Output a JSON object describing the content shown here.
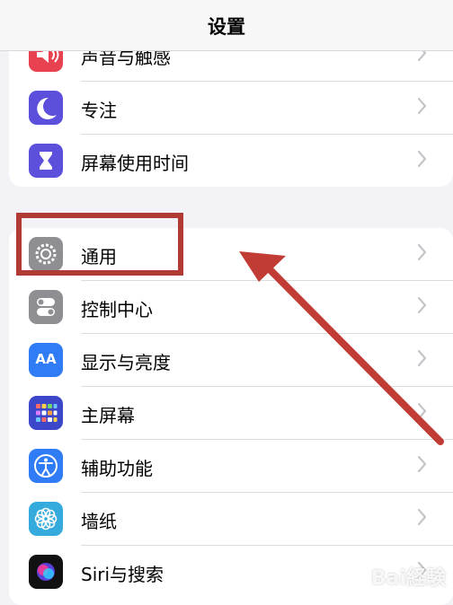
{
  "header": {
    "title": "设置"
  },
  "group1": [
    {
      "label": "声音与触感",
      "icon": "speaker-icon"
    },
    {
      "label": "专注",
      "icon": "moon-icon"
    },
    {
      "label": "屏幕使用时间",
      "icon": "hourglass-icon"
    }
  ],
  "group2": [
    {
      "label": "通用",
      "icon": "gear-icon"
    },
    {
      "label": "控制中心",
      "icon": "toggles-icon"
    },
    {
      "label": "显示与亮度",
      "icon": "aa-icon",
      "icon_text": "AA"
    },
    {
      "label": "主屏幕",
      "icon": "grid-icon"
    },
    {
      "label": "辅助功能",
      "icon": "accessibility-icon"
    },
    {
      "label": "墙纸",
      "icon": "flower-icon"
    },
    {
      "label": "Siri与搜索",
      "icon": "siri-icon"
    }
  ],
  "annotation": {
    "highlight_color": "#b13a35"
  },
  "watermark": "Bai経験"
}
